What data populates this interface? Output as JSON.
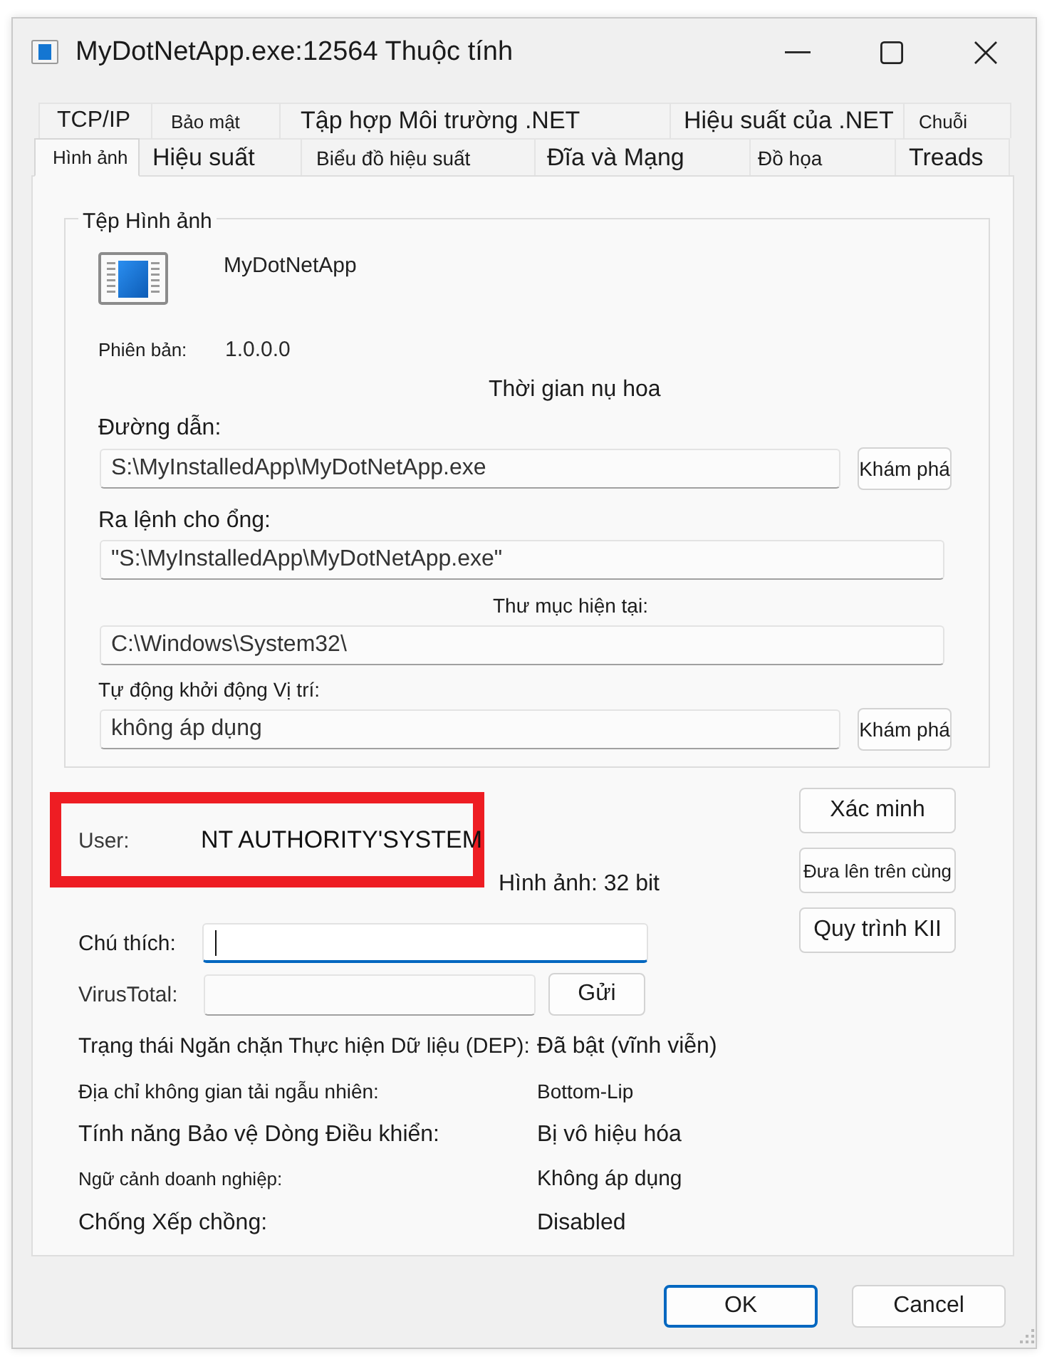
{
  "window": {
    "title": "MyDotNetApp.exe:12564 Thuộc tính"
  },
  "tab_rows": [
    [
      {
        "label": "TCP/IP",
        "selected": false
      },
      {
        "label": "Bảo mật",
        "selected": false
      },
      {
        "label": "Tập hợp Môi trường .NET",
        "selected": false
      },
      {
        "label": "Hiệu suất của .NET",
        "selected": false
      },
      {
        "label": "Chuỗi",
        "selected": false
      }
    ],
    [
      {
        "label": "Hình ảnh",
        "selected": true
      },
      {
        "label": "Hiệu suất",
        "selected": false
      },
      {
        "label": "Biểu đồ hiệu suất",
        "selected": false
      },
      {
        "label": "Đĩa và Mạng",
        "selected": false
      },
      {
        "label": "Đồ họa",
        "selected": false
      },
      {
        "label": "Treads",
        "selected": false
      }
    ]
  ],
  "image_file": {
    "legend": "Tệp Hình ảnh",
    "name": "MyDotNetApp",
    "version": {
      "label": "Phiên bản:",
      "value": "1.0.0.0"
    },
    "timestamp_label": "Thời gian nụ hoa",
    "path": {
      "label": "Đường dẫn:",
      "value": "S:\\MyInstalledApp\\MyDotNetApp.exe",
      "button": "Khám phá"
    },
    "command_line": {
      "label": "Ra lệnh cho ổng:",
      "value": "\"S:\\MyInstalledApp\\MyDotNetApp.exe\""
    },
    "current_directory": {
      "label": "Thư mục hiện tại:",
      "value": "C:\\Windows\\System32\\"
    },
    "autostart_location": {
      "label": "Tự động khởi động Vị trí:",
      "value": "không áp dụng",
      "button": "Khám phá"
    }
  },
  "process": {
    "user": {
      "label": "User:",
      "value": "NT AUTHORITY'SYSTEM",
      "highlighted": true
    },
    "image_type": "Hình ảnh: 32 bit",
    "comment": {
      "label": "Chú thích:",
      "focused": true
    },
    "virustotal": {
      "label": "VirusTotal:",
      "button": "Gửi"
    },
    "actions": [
      "Xác minh",
      "Đưa lên trên cùng",
      "Quy trình KII"
    ]
  },
  "mitigations": [
    {
      "label": "Trạng thái Ngăn chặn Thực hiện Dữ liệu (DEP):",
      "value": "Đã bật (vĩnh viễn)"
    },
    {
      "label": "Địa chỉ không gian tải ngẫu nhiên:",
      "value": "Bottom-Lip"
    },
    {
      "label": "Tính năng Bảo vệ Dòng Điều khiển:",
      "value": "Bị vô hiệu hóa"
    },
    {
      "label": "Ngữ cảnh doanh nghiệp:",
      "value": "Không áp dụng"
    },
    {
      "label": "Chống Xếp chồng:",
      "value": "Disabled"
    }
  ],
  "buttons": [
    {
      "label": "OK",
      "default": true
    },
    {
      "label": "Cancel",
      "default": false
    }
  ]
}
